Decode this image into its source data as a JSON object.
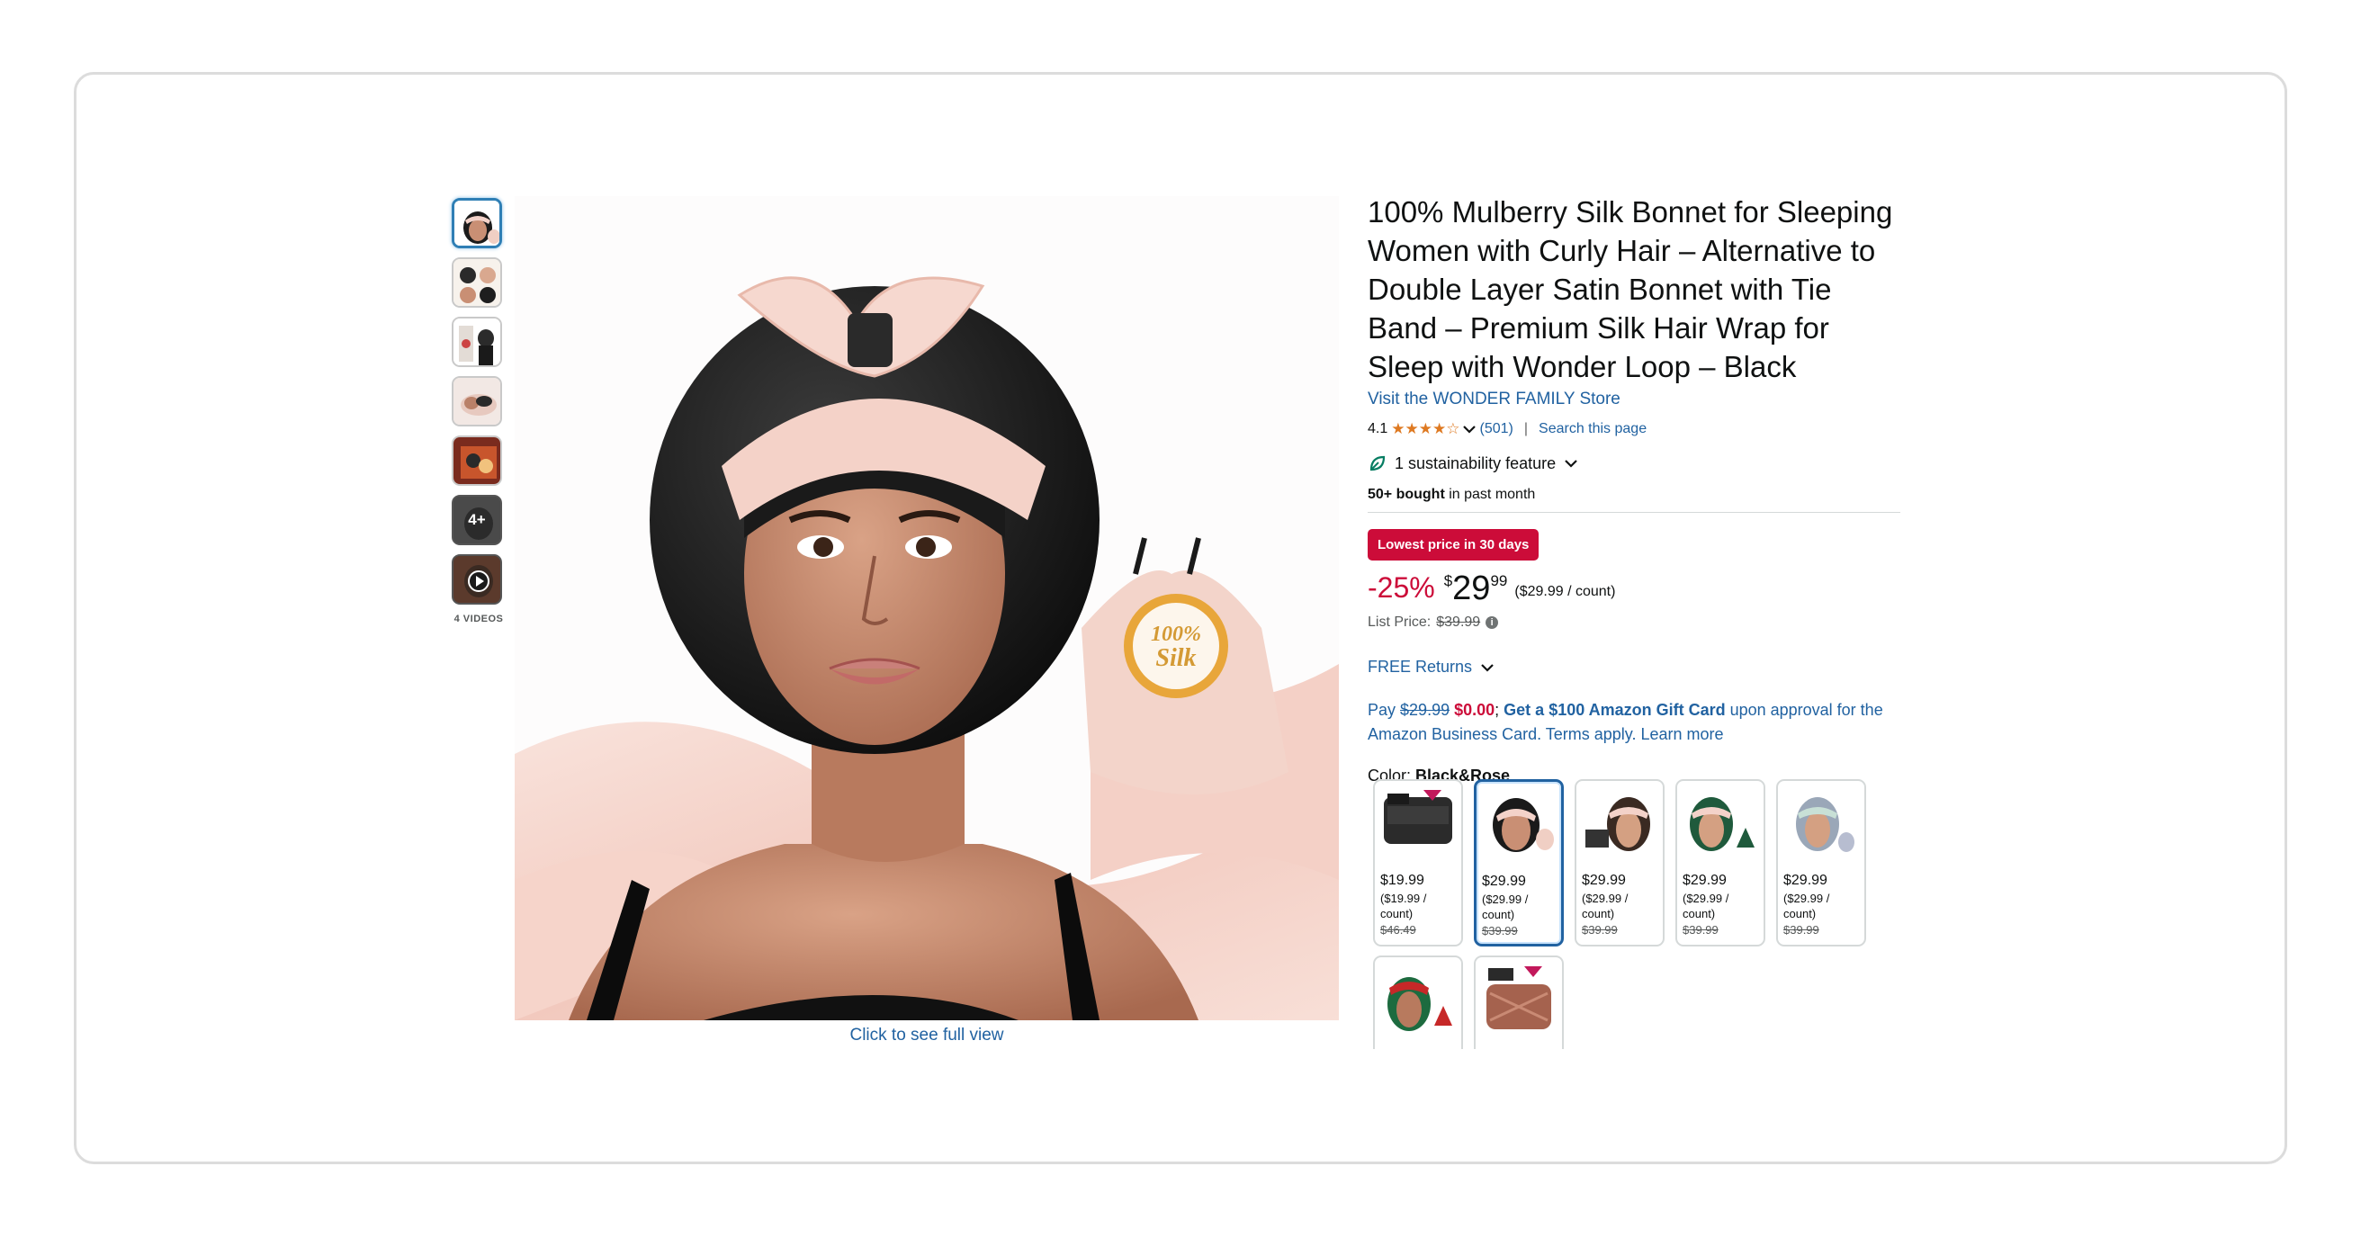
{
  "thumbnails": {
    "more_label": "4+",
    "videos_label": "4 VIDEOS"
  },
  "main_image": {
    "badge_line1": "100%",
    "badge_line2": "Silk",
    "full_view_link": "Click to see full view"
  },
  "product": {
    "title": "100% Mulberry Silk Bonnet for Sleeping Women with Curly Hair – Alternative to Double Layer Satin Bonnet with Tie Band – Premium Silk Hair Wrap for Sleep with Wonder Loop – Black",
    "store_link": "Visit the WONDER FAMILY Store",
    "rating_value": "4.1",
    "rating_stars": 4.1,
    "rating_count": "(501)",
    "search_page": "Search this page",
    "sustainability": "1 sustainability feature",
    "bought_bold": "50+ bought",
    "bought_rest": " in past month"
  },
  "pricing": {
    "deal_badge": "Lowest price in 30 days",
    "discount": "-25%",
    "currency": "$",
    "whole": "29",
    "fraction": "99",
    "unit_price": "($29.99 / count)",
    "list_price_label": "List Price:",
    "list_price": "$39.99"
  },
  "returns": "FREE Returns",
  "promo": {
    "pay": "Pay ",
    "old": "$29.99",
    "new": "$0.00",
    "semi": "; ",
    "offer": "Get a $100 Amazon Gift Card",
    "approval": " upon approval for the Amazon Business Card. ",
    "terms": "Terms apply.",
    "learn": " Learn more"
  },
  "color": {
    "label": "Color: ",
    "selected": "Black&Rose"
  },
  "swatches": [
    {
      "price": "$19.99",
      "unit": "($19.99 / count)",
      "old": "$46.49"
    },
    {
      "price": "$29.99",
      "unit": "($29.99 / count)",
      "old": "$39.99"
    },
    {
      "price": "$29.99",
      "unit": "($29.99 / count)",
      "old": "$39.99"
    },
    {
      "price": "$29.99",
      "unit": "($29.99 / count)",
      "old": "$39.99"
    },
    {
      "price": "$29.99",
      "unit": "($29.99 / count)",
      "old": "$39.99"
    }
  ],
  "colors": {
    "link": "#2162a1",
    "deal_red": "#cc0c39",
    "star": "#de7921"
  }
}
